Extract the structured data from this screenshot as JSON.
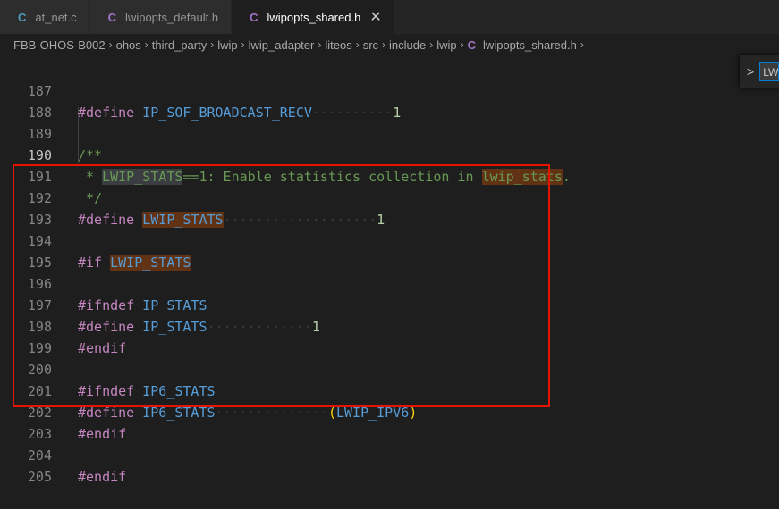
{
  "tabs": [
    {
      "icon": "C",
      "label": "at_net.c",
      "icon_color": "#519aba"
    },
    {
      "icon": "C",
      "label": "lwipopts_default.h",
      "icon_color": "#a074c4"
    },
    {
      "icon": "C",
      "label": "lwipopts_shared.h",
      "icon_color": "#a074c4",
      "close": "✕"
    }
  ],
  "breadcrumb": [
    "FBB-OHOS-B002",
    "ohos",
    "third_party",
    "lwip",
    "lwip_adapter",
    "liteos",
    "src",
    "include",
    "lwip"
  ],
  "breadcrumb_file": {
    "icon": "C",
    "label": "lwipopts_shared.h"
  },
  "breadcrumb_sep": "›",
  "find_widget": {
    "chevron": ">",
    "value": "LW"
  },
  "lines": [
    {
      "n": "187",
      "t": [
        "#define",
        " ",
        "IP_SOF_BROADCAST_RECV",
        "··········",
        "1"
      ]
    },
    {
      "n": "188"
    },
    {
      "n": "189",
      "t": [
        "/**"
      ]
    },
    {
      "n": "190",
      "t": [
        " * ",
        "LWIP_STATS",
        "==1: Enable statistics collection in ",
        "lwip_stats",
        "."
      ]
    },
    {
      "n": "191",
      "t": [
        " */"
      ]
    },
    {
      "n": "192",
      "t": [
        "#define",
        " ",
        "LWIP_STATS",
        "···················",
        "1"
      ]
    },
    {
      "n": "193"
    },
    {
      "n": "194",
      "t": [
        "#if",
        " ",
        "LWIP_STATS"
      ]
    },
    {
      "n": "195"
    },
    {
      "n": "196",
      "t": [
        "#ifndef",
        " ",
        "IP_STATS"
      ]
    },
    {
      "n": "197",
      "t": [
        "#define",
        " ",
        "IP_STATS",
        "·············",
        "1"
      ]
    },
    {
      "n": "198",
      "t": [
        "#endif"
      ]
    },
    {
      "n": "199"
    },
    {
      "n": "200",
      "t": [
        "#ifndef",
        " ",
        "IP6_STATS"
      ]
    },
    {
      "n": "201",
      "t": [
        "#define",
        " ",
        "IP6_STATS",
        "··············",
        "(",
        "LWIP_IPV6",
        ")"
      ]
    },
    {
      "n": "202",
      "t": [
        "#endif"
      ]
    },
    {
      "n": "203"
    },
    {
      "n": "204",
      "t": [
        "#endif"
      ]
    },
    {
      "n": "205"
    }
  ]
}
